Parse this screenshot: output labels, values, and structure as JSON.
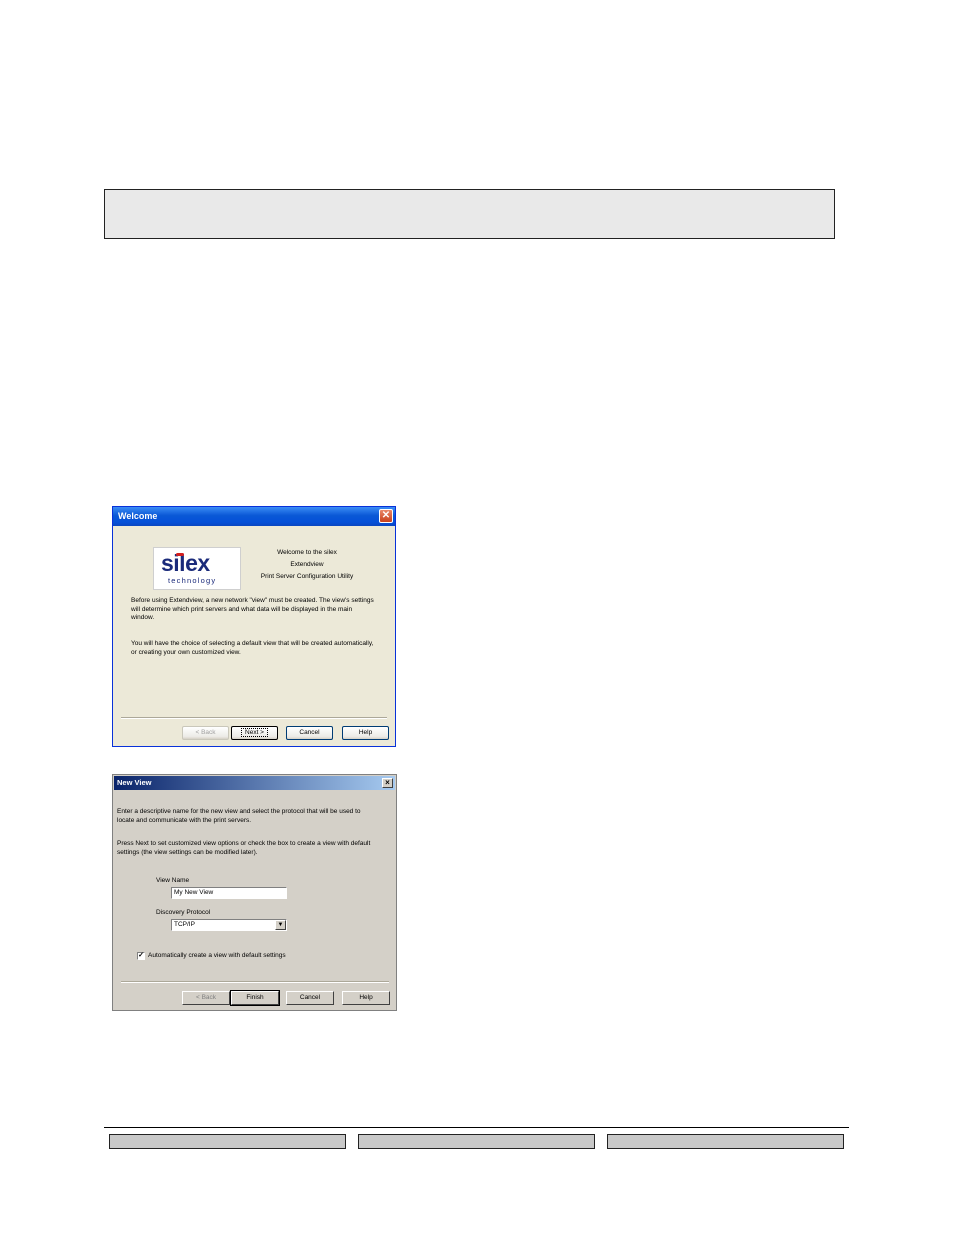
{
  "welcome_dialog": {
    "title": "Welcome",
    "close_glyph": "✕",
    "logo": {
      "brand": "silex",
      "subtitle": "technology"
    },
    "heading_lines": [
      "Welcome to the silex",
      "Extendview",
      "Print Server Configuration Utility"
    ],
    "paragraph1": "Before using Extendview, a new network \"view\" must be created. The view's settings will determine which print servers and what data will be displayed in the main window.",
    "paragraph2": "You will have the choice of selecting a default view that will be created automatically, or creating your own customized view.",
    "buttons": {
      "back": "< Back",
      "next": "Next >",
      "cancel": "Cancel",
      "help": "Help"
    }
  },
  "new_view_dialog": {
    "title": "New View",
    "close_glyph": "×",
    "intro1": "Enter a descriptive name for the new view and select the protocol that will be used to locate and communicate with the print servers.",
    "intro2": "Press Next to set customized view options or check the box to create a view with default settings (the view settings can be modified later).",
    "view_name_label": "View Name",
    "view_name_value": "My New View",
    "protocol_label": "Discovery Protocol",
    "protocol_value": "TCP/IP",
    "select_arrow": "▼",
    "auto_create_label": "Automatically create a view with default settings",
    "auto_create_checked": true,
    "check_glyph": "✓",
    "buttons": {
      "back": "< Back",
      "finish": "Finish",
      "cancel": "Cancel",
      "help": "Help"
    }
  }
}
